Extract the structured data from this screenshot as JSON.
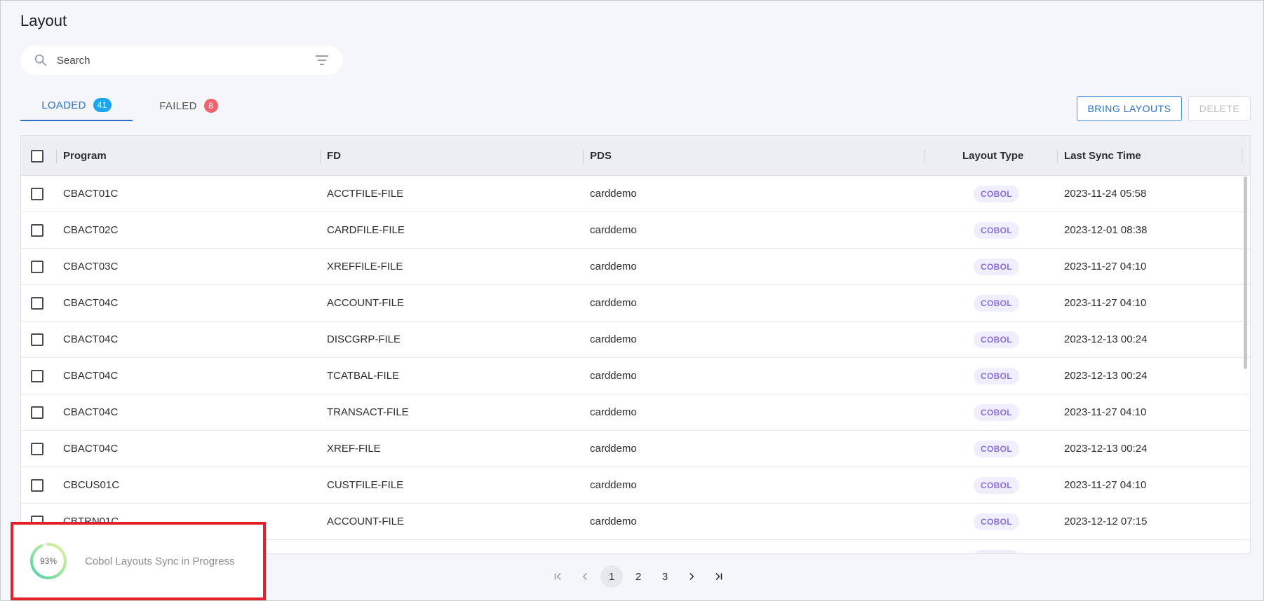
{
  "page": {
    "title": "Layout"
  },
  "search": {
    "placeholder": "Search",
    "value": ""
  },
  "tabs": [
    {
      "label": "LOADED",
      "count": "41",
      "active": true
    },
    {
      "label": "FAILED",
      "count": "8",
      "active": false
    }
  ],
  "toolbar": {
    "bring_label": "BRING LAYOUTS",
    "delete_label": "DELETE"
  },
  "table": {
    "columns": [
      "Program",
      "FD",
      "PDS",
      "Layout Type",
      "Last Sync Time"
    ],
    "rows": [
      {
        "program": "CBACT01C",
        "fd": "ACCTFILE-FILE",
        "pds": "carddemo",
        "type": "COBOL",
        "sync": "2023-11-24 05:58"
      },
      {
        "program": "CBACT02C",
        "fd": "CARDFILE-FILE",
        "pds": "carddemo",
        "type": "COBOL",
        "sync": "2023-12-01 08:38"
      },
      {
        "program": "CBACT03C",
        "fd": "XREFFILE-FILE",
        "pds": "carddemo",
        "type": "COBOL",
        "sync": "2023-11-27 04:10"
      },
      {
        "program": "CBACT04C",
        "fd": "ACCOUNT-FILE",
        "pds": "carddemo",
        "type": "COBOL",
        "sync": "2023-11-27 04:10"
      },
      {
        "program": "CBACT04C",
        "fd": "DISCGRP-FILE",
        "pds": "carddemo",
        "type": "COBOL",
        "sync": "2023-12-13 00:24"
      },
      {
        "program": "CBACT04C",
        "fd": "TCATBAL-FILE",
        "pds": "carddemo",
        "type": "COBOL",
        "sync": "2023-12-13 00:24"
      },
      {
        "program": "CBACT04C",
        "fd": "TRANSACT-FILE",
        "pds": "carddemo",
        "type": "COBOL",
        "sync": "2023-11-27 04:10"
      },
      {
        "program": "CBACT04C",
        "fd": "XREF-FILE",
        "pds": "carddemo",
        "type": "COBOL",
        "sync": "2023-12-13 00:24"
      },
      {
        "program": "CBCUS01C",
        "fd": "CUSTFILE-FILE",
        "pds": "carddemo",
        "type": "COBOL",
        "sync": "2023-11-27 04:10"
      },
      {
        "program": "CBTRN01C",
        "fd": "ACCOUNT-FILE",
        "pds": "carddemo",
        "type": "COBOL",
        "sync": "2023-12-12 07:15"
      },
      {
        "program": "",
        "fd": "",
        "pds": "",
        "type": "COBOL",
        "sync": ""
      }
    ]
  },
  "pagination": {
    "pages": [
      "1",
      "2",
      "3"
    ],
    "current": "1"
  },
  "toast": {
    "progress": "93%",
    "progress_value": 0.93,
    "message": "Cobol Layouts Sync in Progress"
  },
  "colors": {
    "accent": "#2a6fc9",
    "badge_blue": "#1aa6f2",
    "badge_red": "#f0636d",
    "cobol_text": "#8a6fe0",
    "toast_border": "#e3212b"
  },
  "icons": {
    "search": "search-icon",
    "filter": "filter-icon",
    "first": "first-page-icon",
    "prev": "chevron-left-icon",
    "next": "chevron-right-icon",
    "last": "last-page-icon"
  }
}
